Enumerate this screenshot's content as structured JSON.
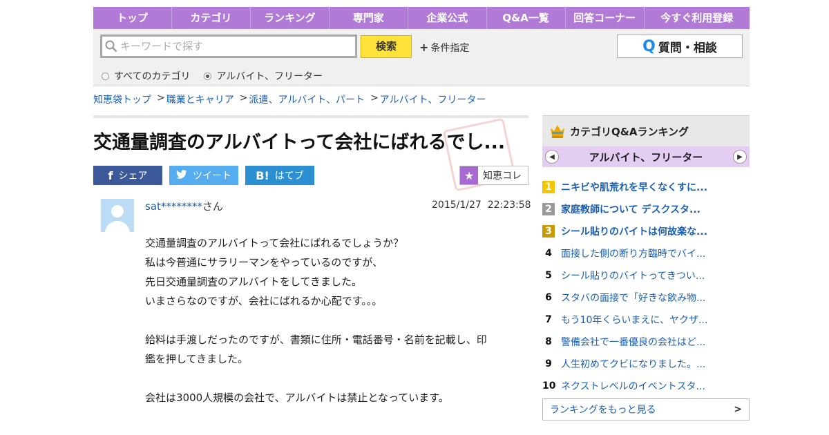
{
  "nav": {
    "items": [
      "トップ",
      "カテゴリ",
      "ランキング",
      "専門家",
      "企業公式",
      "Q&A一覧",
      "回答コーナー",
      "今すぐ利用登録"
    ]
  },
  "search": {
    "placeholder": "キーワードで探す",
    "button": "検索",
    "conditions": "条件指定",
    "ask_button": "質問・相談",
    "ask_icon": "Q",
    "scope_all": "すべてのカテゴリ",
    "scope_current": "アルバイト、フリーター",
    "selected_scope": "current"
  },
  "breadcrumb": [
    "知恵袋トップ",
    "職業とキャリア",
    "派遣、アルバイト、パート",
    "アルバイト、フリーター"
  ],
  "question": {
    "title": "交通量調査のアルバイトって会社にばれるでし...",
    "share": {
      "facebook": "シェア",
      "twitter": "ツイート",
      "hatena": "はてブ",
      "hatena_icon": "B!"
    },
    "chiekore": "知恵コレ",
    "user_name": "sat********",
    "user_suffix": "さん",
    "date": "2015/1/27",
    "time": "22:23:58",
    "body": [
      "交通量調査のアルバイトって会社にばれるでしょうか？",
      "私は今普通にサラリーマンをやっているのですが、",
      "先日交通量調査のアルバイトをしてきました。",
      "いまさらなのですが、会社にばれるか心配です。。。",
      "",
      "給料は手渡しだったのですが、書類に住所・電話番号・名前を記載し、印",
      "鑑を押してきました。",
      "",
      "会社は3000人規模の会社で、アルバイトは禁止となっています。"
    ]
  },
  "sidebar": {
    "title": "カテゴリQ&Aランキング",
    "category": "アルバイト、フリーター",
    "ranking": [
      {
        "rank": "1",
        "text": "ニキビや肌荒れを早くなくすに..."
      },
      {
        "rank": "2",
        "text": "家庭教師について デスクスタ..."
      },
      {
        "rank": "3",
        "text": "シール貼りのバイトは何故楽な..."
      },
      {
        "rank": "4",
        "text": "面接した側の断り方臨時でバイ..."
      },
      {
        "rank": "5",
        "text": "シール貼りのバイトってきつい..."
      },
      {
        "rank": "6",
        "text": "スタバの面接で「好きな飲み物..."
      },
      {
        "rank": "7",
        "text": "もう10年くらいまえに、ヤクザ..."
      },
      {
        "rank": "8",
        "text": "警備会社で一番優良の会社はど..."
      },
      {
        "rank": "9",
        "text": "人生初めてクビになりました。..."
      },
      {
        "rank": "10",
        "text": "ネクストレベルのイベントスタ..."
      }
    ],
    "more": "ランキングをもっと見る"
  },
  "colors": {
    "nav": "#b07ad6",
    "search_button": "#ffe23a",
    "link": "#1a5fb4",
    "facebook": "#3b5998",
    "twitter": "#55acee",
    "hatena": "#2b8fd2",
    "category_bar": "#e3cdf3"
  }
}
